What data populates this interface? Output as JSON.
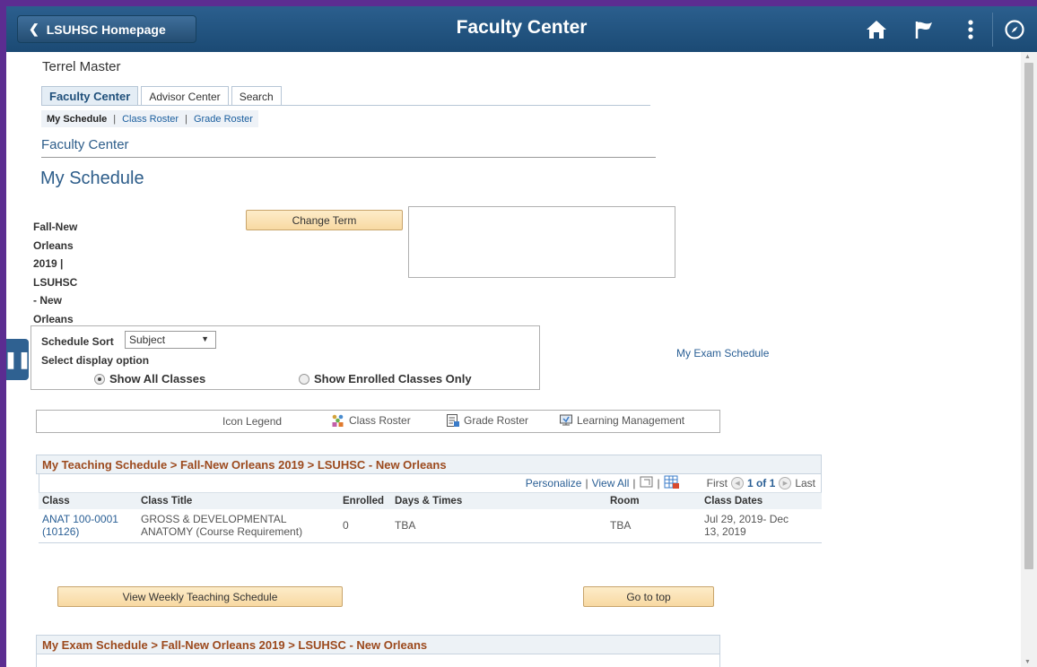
{
  "header": {
    "back_label": "LSUHSC Homepage",
    "title": "Faculty Center",
    "icons": [
      "home-icon",
      "flag-icon",
      "more-vertical-icon",
      "navbar-compass-icon"
    ]
  },
  "user": {
    "name": "Terrel Master"
  },
  "tabs": [
    {
      "label": "Faculty Center",
      "active": true
    },
    {
      "label": "Advisor Center",
      "active": false
    },
    {
      "label": "Search",
      "active": false
    }
  ],
  "subnav": {
    "current": "My Schedule",
    "sep1": "|",
    "class_roster": "Class Roster",
    "sep2": "|",
    "grade_roster": "Grade Roster"
  },
  "page": {
    "section": "Faculty Center",
    "title": "My Schedule",
    "term_lines": [
      "Fall-New",
      "Orleans",
      "2019 |",
      "LSUHSC",
      "- New",
      "Orleans"
    ],
    "change_term_label": "Change Term"
  },
  "sort": {
    "label": "Schedule Sort",
    "selected": "Subject",
    "display_label": "Select display option",
    "option_all": "Show All Classes",
    "option_enrolled": "Show Enrolled Classes Only",
    "selected_option": "all"
  },
  "exam_link": "My Exam Schedule",
  "legend": {
    "label": "Icon Legend",
    "class_roster": "Class Roster",
    "grade_roster": "Grade Roster",
    "learning": "Learning Management"
  },
  "teaching": {
    "title": "My Teaching Schedule > Fall-New Orleans 2019 > LSUHSC - New Orleans",
    "personalize": "Personalize",
    "view_all": "View All",
    "first": "First",
    "page_info": "1 of 1",
    "last": "Last",
    "columns": [
      "Class",
      "Class Title",
      "Enrolled",
      "Days & Times",
      "Room",
      "Class Dates"
    ],
    "rows": [
      {
        "class_line1": "ANAT 100-0001",
        "class_line2": "(10126)",
        "title_line1": "GROSS & DEVELOPMENTAL",
        "title_line2": "ANATOMY (Course Requirement)",
        "enrolled": "0",
        "days": "TBA",
        "room": "TBA",
        "dates_line1": "Jul 29, 2019- Dec",
        "dates_line2": "13, 2019"
      }
    ]
  },
  "buttons": {
    "weekly": "View Weekly Teaching Schedule",
    "top": "Go to top"
  },
  "exam": {
    "title": "My Exam Schedule > Fall-New Orleans 2019 > LSUHSC - New Orleans"
  }
}
